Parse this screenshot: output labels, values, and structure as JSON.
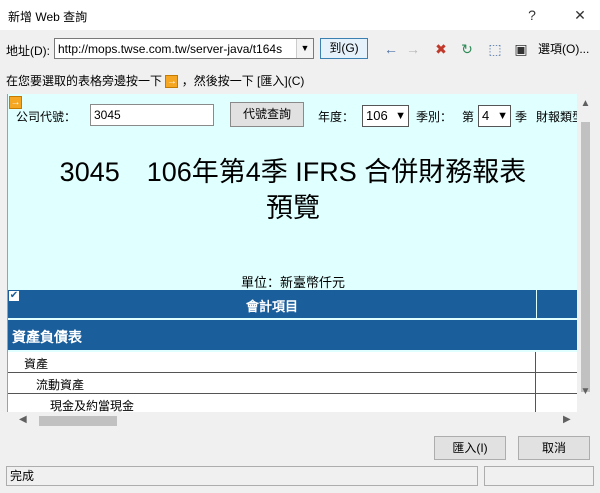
{
  "window": {
    "title": "新增 Web 查詢",
    "help": "?",
    "close": "✕"
  },
  "address": {
    "label": "地址(D):",
    "url": "http://mops.twse.com.tw/server-java/t164s",
    "go_label": "到(G)",
    "options_label": "選項(O)..."
  },
  "hint": {
    "before": "在您要選取的表格旁邊按一下",
    "marker": "→",
    "after": "，然後按一下 [匯入](C)"
  },
  "form": {
    "company_label": "公司代號：",
    "company_value": "3045",
    "lookup_button": "代號查詢",
    "year_label": "年度：",
    "year_value": "106",
    "season_label": "季別：",
    "season_prefix": "第",
    "season_value": "4",
    "season_suffix": "季",
    "report_type_label": "財報類型"
  },
  "report": {
    "title_line1": "3045　106年第4季 IFRS 合併財務報表",
    "title_line2": "預覽",
    "unit": "單位：新臺幣仟元"
  },
  "table": {
    "header": "會計項目",
    "section": "資產負債表",
    "rows": [
      {
        "label": "資產"
      },
      {
        "label": "流動資產"
      },
      {
        "label": "現金及約當現金"
      }
    ]
  },
  "buttons": {
    "import": "匯入(I)",
    "cancel": "取消"
  },
  "status": {
    "text": "完成"
  }
}
